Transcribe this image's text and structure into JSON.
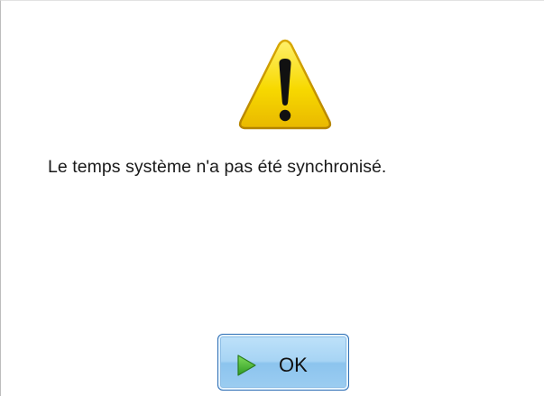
{
  "dialog": {
    "icon": "warning-icon",
    "message": "Le temps système n'a pas été synchronisé.",
    "ok_button": {
      "label": "OK",
      "icon": "play-arrow-icon"
    }
  },
  "colors": {
    "warning_yellow": "#f5d400",
    "arrow_green": "#3fa92e",
    "button_blue": "#a7d4f4",
    "button_border": "#2f6fb5"
  }
}
